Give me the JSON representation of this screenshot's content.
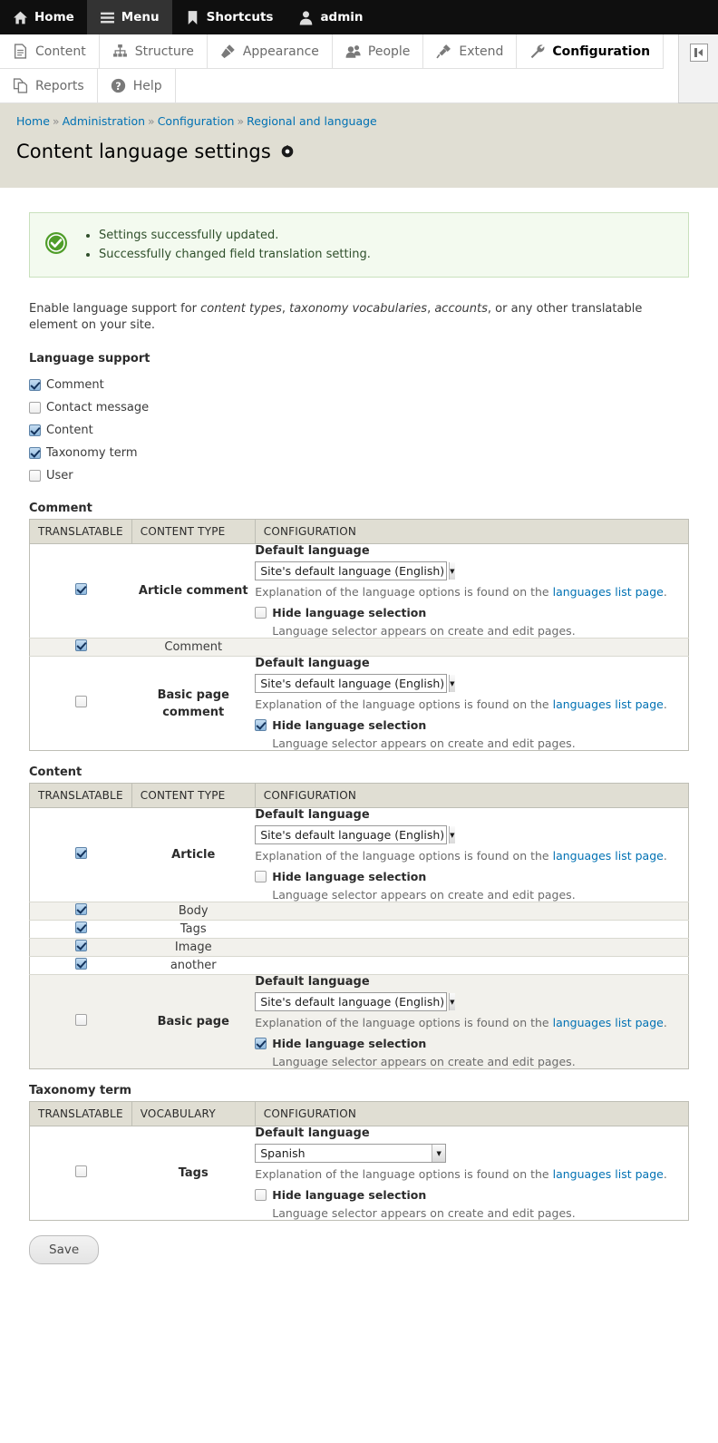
{
  "toolbar": {
    "items": [
      {
        "label": "Home",
        "icon": "home-icon",
        "active": false
      },
      {
        "label": "Menu",
        "icon": "hamburger-icon",
        "active": true
      },
      {
        "label": "Shortcuts",
        "icon": "bookmark-icon",
        "active": false
      },
      {
        "label": "admin",
        "icon": "user-icon",
        "active": false
      }
    ]
  },
  "admin_menu": {
    "items": [
      {
        "label": "Content",
        "icon": "document-icon",
        "active": false
      },
      {
        "label": "Structure",
        "icon": "sitemap-icon",
        "active": false
      },
      {
        "label": "Appearance",
        "icon": "paintbrush-icon",
        "active": false
      },
      {
        "label": "People",
        "icon": "people-icon",
        "active": false
      },
      {
        "label": "Extend",
        "icon": "plug-icon",
        "active": false
      },
      {
        "label": "Configuration",
        "icon": "wrench-icon",
        "active": true
      },
      {
        "label": "Reports",
        "icon": "reports-icon",
        "active": false
      },
      {
        "label": "Help",
        "icon": "question-icon",
        "active": false
      }
    ],
    "collapse_icon": "collapse-left-icon"
  },
  "breadcrumb": {
    "items": [
      "Home",
      "Administration",
      "Configuration",
      "Regional and language"
    ],
    "separator": "»"
  },
  "page": {
    "title": "Content language settings",
    "title_icon": "gear-icon"
  },
  "messages": {
    "status_icon": "check-circle-icon",
    "items": [
      "Settings successfully updated.",
      "Successfully changed field translation setting."
    ]
  },
  "intro": {
    "pre": "Enable language support for ",
    "em1": "content types",
    "mid1": ", ",
    "em2": "taxonomy vocabularies",
    "mid2": ", ",
    "em3": "accounts",
    "post": ", or any other translatable element on your site."
  },
  "language_support": {
    "label": "Language support",
    "options": [
      {
        "label": "Comment",
        "checked": true
      },
      {
        "label": "Contact message",
        "checked": false
      },
      {
        "label": "Content",
        "checked": true
      },
      {
        "label": "Taxonomy term",
        "checked": true
      },
      {
        "label": "User",
        "checked": false
      }
    ]
  },
  "common": {
    "default_language_label": "Default language",
    "help_prefix": "Explanation of the language options is found on the ",
    "help_link": "languages list page",
    "help_suffix": ".",
    "hide_label": "Hide language selection",
    "selector_desc": "Language selector appears on create and edit pages."
  },
  "tables": [
    {
      "title": "Comment",
      "headers": [
        "TRANSLATABLE",
        "CONTENT TYPE",
        "CONFIGURATION"
      ],
      "rows": [
        {
          "kind": "full",
          "shaded": false,
          "translatable": true,
          "name": "Article comment",
          "default_language": "Site's default language (English)",
          "select_width": "w-default",
          "hide_selection": false
        },
        {
          "kind": "simple",
          "shaded": true,
          "translatable": true,
          "name": "Comment"
        },
        {
          "kind": "full",
          "shaded": false,
          "translatable": false,
          "name": "Basic page comment",
          "default_language": "Site's default language (English)",
          "select_width": "w-default",
          "hide_selection": true
        }
      ]
    },
    {
      "title": "Content",
      "headers": [
        "TRANSLATABLE",
        "CONTENT TYPE",
        "CONFIGURATION"
      ],
      "rows": [
        {
          "kind": "full",
          "shaded": false,
          "translatable": true,
          "name": "Article",
          "default_language": "Site's default language (English)",
          "select_width": "w-default",
          "hide_selection": false
        },
        {
          "kind": "simple",
          "shaded": true,
          "translatable": true,
          "name": "Body"
        },
        {
          "kind": "simple",
          "shaded": false,
          "translatable": true,
          "name": "Tags"
        },
        {
          "kind": "simple",
          "shaded": true,
          "translatable": true,
          "name": "Image"
        },
        {
          "kind": "simple",
          "shaded": false,
          "translatable": true,
          "name": "another"
        },
        {
          "kind": "full",
          "shaded": true,
          "translatable": false,
          "name": "Basic page",
          "default_language": "Site's default language (English)",
          "select_width": "w-default",
          "hide_selection": true
        }
      ]
    },
    {
      "title": "Taxonomy term",
      "headers": [
        "TRANSLATABLE",
        "VOCABULARY",
        "CONFIGURATION"
      ],
      "rows": [
        {
          "kind": "full",
          "shaded": false,
          "translatable": false,
          "name": "Tags",
          "default_language": "Spanish",
          "select_width": "w-spanish",
          "hide_selection": false
        }
      ]
    }
  ],
  "actions": {
    "save_label": "Save"
  },
  "colors": {
    "toolbar_bg": "#0f0f0f",
    "page_head_bg": "#e0ded3",
    "link": "#0071b3",
    "status_border": "#c9e1bd",
    "status_bg": "#f3faef",
    "status_green": "#4f9d29"
  }
}
